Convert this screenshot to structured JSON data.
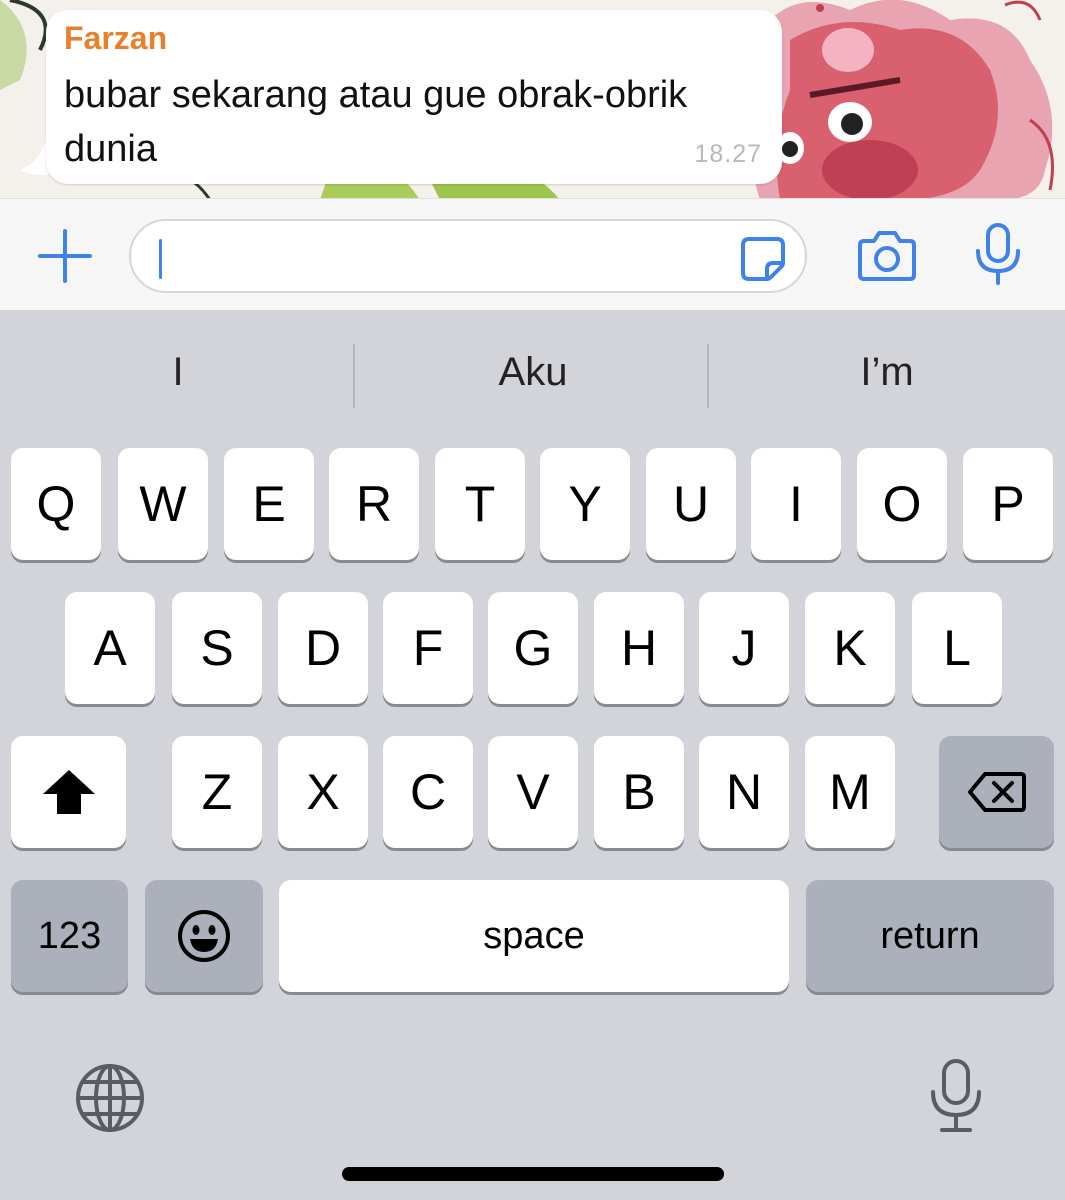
{
  "message": {
    "sender": "Farzan",
    "text": "bubar sekarang atau gue obrak-obrik dunia",
    "time": "18.27"
  },
  "composer": {
    "text_value": "",
    "icons": [
      "plus-icon",
      "sticker-icon",
      "camera-icon",
      "microphone-icon"
    ]
  },
  "suggestions": [
    "I",
    "Aku",
    "I’m"
  ],
  "keyboard": {
    "row1": [
      "Q",
      "W",
      "E",
      "R",
      "T",
      "Y",
      "U",
      "I",
      "O",
      "P"
    ],
    "row2": [
      "A",
      "S",
      "D",
      "F",
      "G",
      "H",
      "J",
      "K",
      "L"
    ],
    "row3": [
      "Z",
      "X",
      "C",
      "V",
      "B",
      "N",
      "M"
    ],
    "numbers_label": "123",
    "space_label": "space",
    "return_label": "return",
    "icons": [
      "shift-icon",
      "backspace-icon",
      "emoji-icon",
      "globe-icon",
      "dictation-icon"
    ]
  },
  "colors": {
    "sender": "#e8802b",
    "accent": "#3f83e8",
    "keyboard_bg": "#d2d4d9",
    "key_bg": "#ffffff",
    "function_key_bg": "#abb0ba"
  }
}
